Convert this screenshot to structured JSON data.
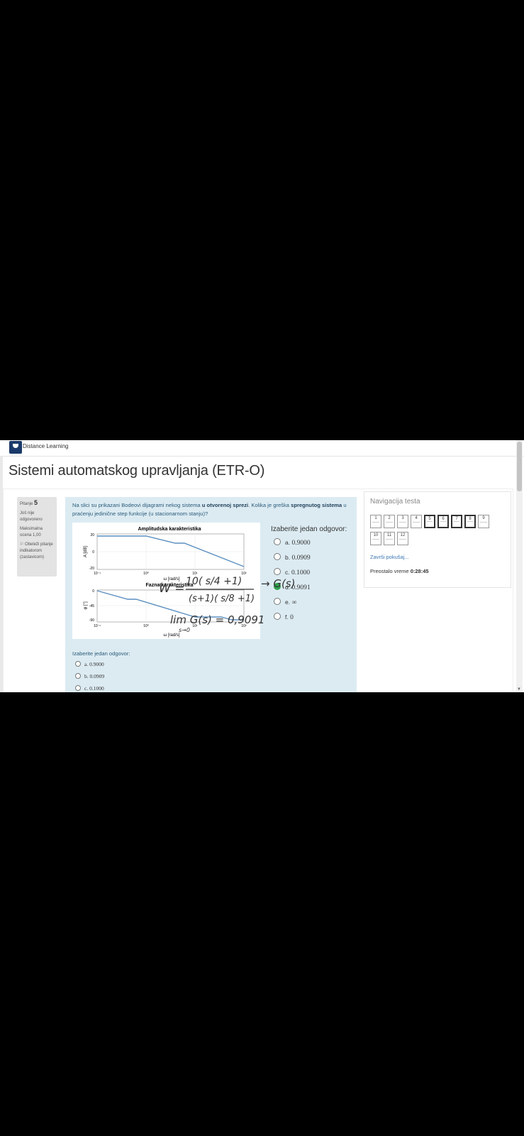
{
  "header": {
    "site_name": "Distance Learning"
  },
  "course": {
    "title": "Sistemi automatskog upravljanja (ETR-O)"
  },
  "question_info": {
    "label": "Pitanje",
    "number": "5",
    "status": "Još nije odgovoreno",
    "max_grade": "Maksimalna ocena 1,00",
    "flag": "Obeleži pitanje indikatorom (zastavicom)"
  },
  "question": {
    "text_1": "Na slici su prikazani Bodeovi dijagrami nekog sistema ",
    "bold_1": "u otvorenoj sprezi",
    "text_2": ". Kolika je greška ",
    "bold_2": "spregnutog sistema",
    "text_3": " u praćenju jedinične step funkcije (u stacionarnom stanju)?",
    "answer_prompt": "Izaberite jedan odgovor:",
    "options": [
      {
        "letter": "a.",
        "value": "0.9000",
        "selected": false
      },
      {
        "letter": "b.",
        "value": "0.0909",
        "selected": false
      },
      {
        "letter": "c.",
        "value": "0.1000",
        "selected": false
      },
      {
        "letter": "d.",
        "value": "0.9091",
        "selected": true
      },
      {
        "letter": "e.",
        "value": "∞",
        "selected": false
      },
      {
        "letter": "f.",
        "value": "0",
        "selected": false
      }
    ],
    "lower_prompt": "Izaberite jedan odgovor:",
    "lower_options": [
      {
        "letter": "a.",
        "value": "0.9000"
      },
      {
        "letter": "b.",
        "value": "0.0909"
      },
      {
        "letter": "c.",
        "value": "0.1000"
      }
    ]
  },
  "figure": {
    "amp_title": "Amplitudska karakteristika",
    "amp_ylabel": "A [dB]",
    "amp_yticks": [
      "20",
      "0",
      "-20"
    ],
    "phase_title": "Fazna karakteristika",
    "phase_ylabel": "φ [°]",
    "phase_yticks": [
      "0",
      "-45",
      "-90"
    ],
    "xticks": [
      "10⁻¹",
      "10⁰",
      "10¹",
      "10²"
    ],
    "xlabel": "ω [rad/s]"
  },
  "handwriting": {
    "line1_w": "W =",
    "numerator": "10( s/4 +1)",
    "denominator": "(s+1)( s/8 +1)",
    "arrow_g": "→ G(s)",
    "limit": "lim G(s) = 0,9091",
    "limit_sub": "s→0"
  },
  "nav": {
    "title": "Navigacija testa",
    "buttons": [
      {
        "label": "1",
        "marked": false
      },
      {
        "label": "2",
        "marked": false
      },
      {
        "label": "3",
        "marked": false
      },
      {
        "label": "4",
        "marked": false
      },
      {
        "label": "5",
        "marked": true
      },
      {
        "label": "6",
        "marked": true
      },
      {
        "label": "7",
        "marked": true
      },
      {
        "label": "8",
        "marked": true
      },
      {
        "label": "9",
        "marked": false
      },
      {
        "label": "10",
        "marked": false
      },
      {
        "label": "11",
        "marked": false
      },
      {
        "label": "12",
        "marked": false
      }
    ],
    "finish_link": "Završi pokušaj...",
    "time_label": "Preostalo vreme",
    "time_value": "0:28:45"
  },
  "colors": {
    "accent": "#3a77b2",
    "question_bg": "#dcebf2",
    "selected": "#2ea04b",
    "plot_line": "#5b8fc0"
  }
}
